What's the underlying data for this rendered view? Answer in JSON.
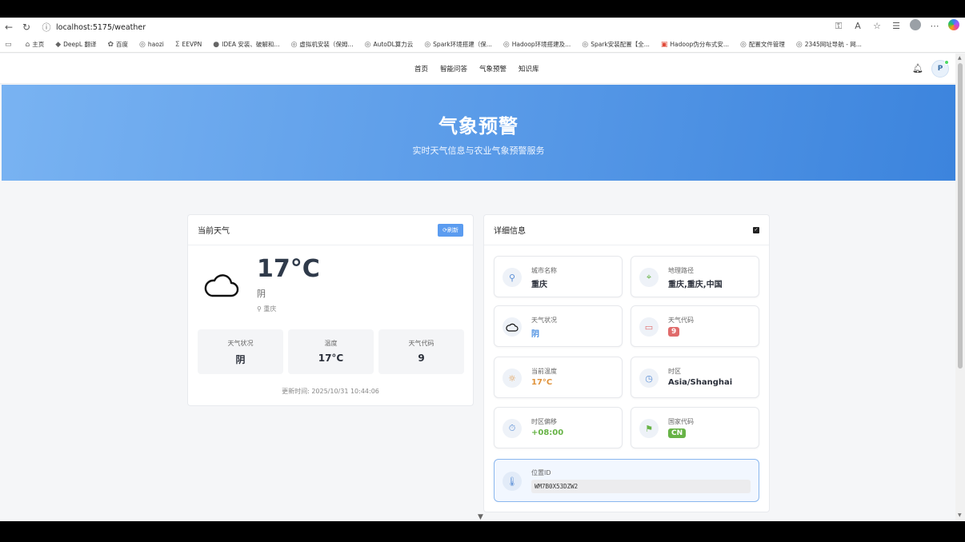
{
  "browser": {
    "url": "localhost:5175/weather",
    "bookmarks": [
      "主页",
      "DeepL 翻译",
      "百度",
      "haozi",
      "EEVPN",
      "IDEA 安装、破解和...",
      "虚拟机安装（保姆...",
      "AutoDL算力云",
      "Spark环境搭建（保...",
      "Hadoop环境搭建及...",
      "Spark安装配置【全...",
      "Hadoop伪分布式安...",
      "配置文件管理",
      "2345网址导航 - 网..."
    ]
  },
  "nav": {
    "items": [
      "首页",
      "智能问答",
      "气象预警",
      "知识库"
    ],
    "avatar": "P"
  },
  "hero": {
    "title": "气象预警",
    "subtitle": "实时天气信息与农业气象预警服务"
  },
  "current": {
    "title": "当前天气",
    "refresh": "⟳刷新",
    "temperature": "17°C",
    "condition": "阴",
    "location": "重庆",
    "stats": [
      {
        "label": "天气状况",
        "value": "阴"
      },
      {
        "label": "温度",
        "value": "17°C"
      },
      {
        "label": "天气代码",
        "value": "9"
      }
    ],
    "updated": "更新时间: 2025/10/31 10:44:06"
  },
  "details": {
    "title": "详细信息",
    "tiles": [
      {
        "label": "城市名称",
        "value": "重庆"
      },
      {
        "label": "地理路径",
        "value": "重庆,重庆,中国"
      },
      {
        "label": "天气状况",
        "value": "阴"
      },
      {
        "label": "天气代码",
        "value": "9"
      },
      {
        "label": "当前温度",
        "value": "17°C"
      },
      {
        "label": "时区",
        "value": "Asia/Shanghai"
      },
      {
        "label": "时区偏移",
        "value": "+08:00"
      },
      {
        "label": "国家代码",
        "value": "CN"
      }
    ],
    "location_id_label": "位置ID",
    "location_id": "WM7B0X53DZW2"
  },
  "colors": {
    "accent": "#4a8fe2",
    "orange": "#e0923a",
    "green": "#67b346",
    "red": "#e06b6b"
  }
}
